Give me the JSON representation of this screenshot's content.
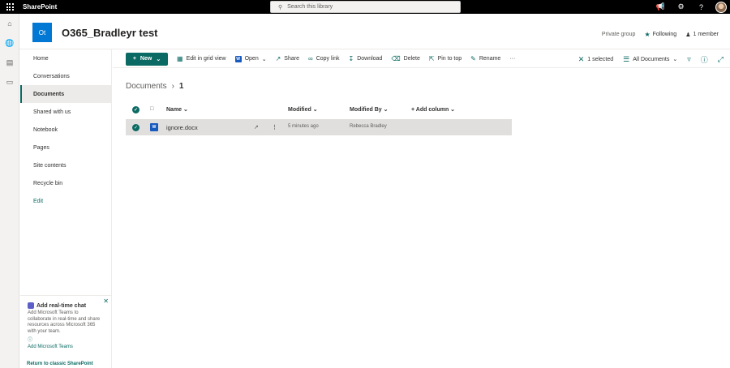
{
  "suite": {
    "brand": "SharePoint",
    "search_placeholder": "Search this library"
  },
  "site": {
    "logo_text": "Ot",
    "title": "O365_Bradleyr test",
    "privacy": "Private group",
    "following": "Following",
    "members": "1 member"
  },
  "nav": {
    "items": [
      {
        "label": "Home"
      },
      {
        "label": "Conversations"
      },
      {
        "label": "Documents",
        "active": true
      },
      {
        "label": "Shared with us"
      },
      {
        "label": "Notebook"
      },
      {
        "label": "Pages"
      },
      {
        "label": "Site contents"
      },
      {
        "label": "Recycle bin"
      },
      {
        "label": "Edit"
      }
    ]
  },
  "chat_card": {
    "title": "Add real-time chat",
    "body": "Add Microsoft Teams to collaborate in real-time and share resources across Microsoft 365 with your team.",
    "link": "Add Microsoft Teams"
  },
  "classic_link": "Return to classic SharePoint",
  "commands": {
    "new": "New",
    "edit_grid": "Edit in grid view",
    "open": "Open",
    "share": "Share",
    "copy_link": "Copy link",
    "download": "Download",
    "delete": "Delete",
    "pin_to_top": "Pin to top",
    "rename": "Rename",
    "more": "···",
    "selected": "1 selected",
    "view": "All Documents"
  },
  "breadcrumb": {
    "parent": "Documents",
    "current": "1"
  },
  "columns": {
    "name": "Name",
    "modified": "Modified",
    "modified_by": "Modified By",
    "add_column": "+ Add column"
  },
  "files": [
    {
      "name": "ignore.docx",
      "modified": "5 minutes ago",
      "modified_by": "Rebecca Bradley"
    }
  ],
  "colors": {
    "accent": "#0b6a64",
    "suitebar": "#000000",
    "site_logo": "#0078d4",
    "selected_row": "#e1dfdd"
  }
}
